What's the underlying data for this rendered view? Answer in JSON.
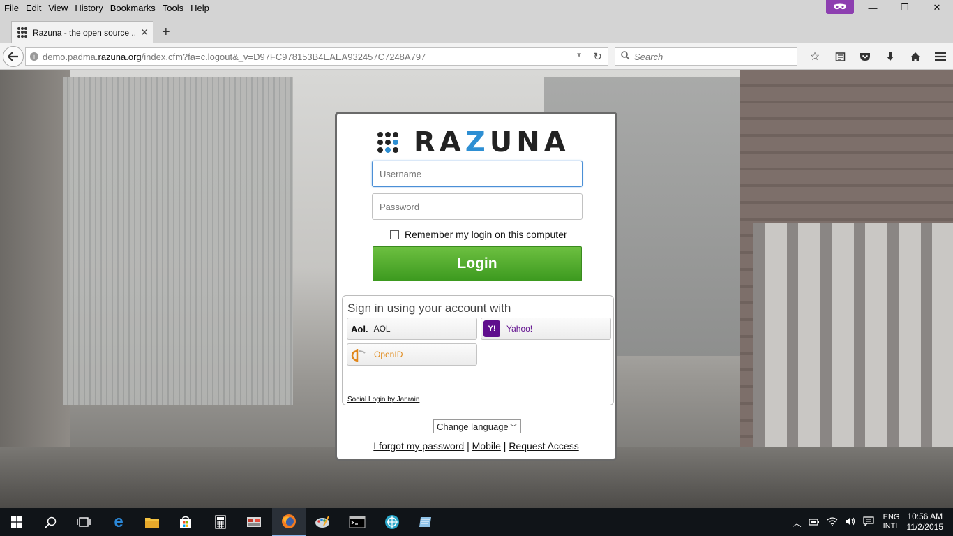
{
  "menu": [
    "File",
    "Edit",
    "View",
    "History",
    "Bookmarks",
    "Tools",
    "Help"
  ],
  "window": {
    "minimize": "—",
    "restore": "❐",
    "close": "✕"
  },
  "tab": {
    "title": "Razuna - the open source ...",
    "close": "✕"
  },
  "newtab_label": "+",
  "nav": {
    "url_prefix": "demo.padma.",
    "url_domain": "razuna.org",
    "url_suffix": "/index.cfm?fa=c.logout&_v=D97FC978153B4EAEA932457C7248A797",
    "search_placeholder": "Search"
  },
  "login": {
    "logo_text": "RAZUNA",
    "username_placeholder": "Username",
    "password_placeholder": "Password",
    "remember_label": "Remember my login on this computer",
    "login_button": "Login",
    "social_title": "Sign in using your account with",
    "providers": {
      "aol_badge": "Aol.",
      "aol": "AOL",
      "yahoo": "Yahoo!",
      "openid": "OpenID"
    },
    "janrain": "Social Login by Janrain",
    "language_select": "Change language",
    "forgot": "I forgot my password",
    "mobile": "Mobile",
    "request": "Request Access",
    "separator": "|"
  },
  "taskbar": {
    "lang_line1": "ENG",
    "lang_line2": "INTL",
    "time": "10:56 AM",
    "date": "11/2/2015"
  },
  "colors": {
    "login_green": "#4caf2c",
    "logo_blue": "#2e8fd3",
    "yahoo_purple": "#5f0d8d",
    "private_badge": "#8d3fb0"
  }
}
